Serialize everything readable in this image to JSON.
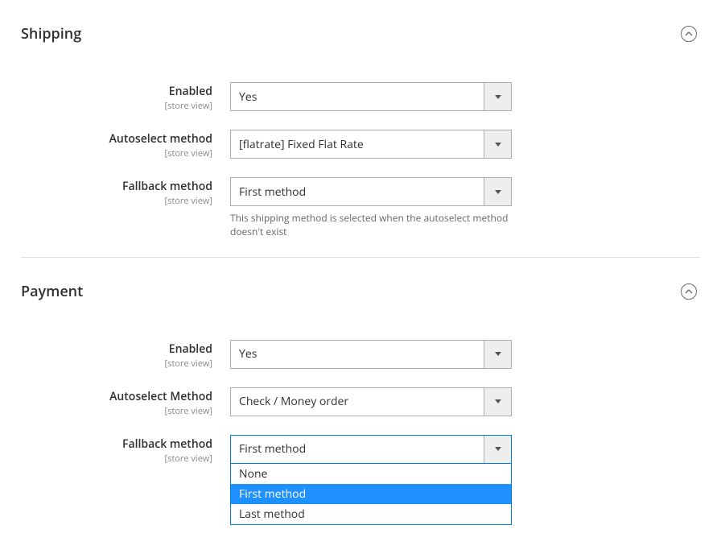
{
  "scope_label": "[store view]",
  "shipping": {
    "title": "Shipping",
    "enabled": {
      "label": "Enabled",
      "value": "Yes"
    },
    "autoselect": {
      "label": "Autoselect method",
      "value": "[flatrate] Fixed Flat Rate"
    },
    "fallback": {
      "label": "Fallback method",
      "value": "First method",
      "note": "This shipping method is selected when the autoselect method doesn't exist"
    }
  },
  "payment": {
    "title": "Payment",
    "enabled": {
      "label": "Enabled",
      "value": "Yes"
    },
    "autoselect": {
      "label": "Autoselect Method",
      "value": "Check / Money order"
    },
    "fallback": {
      "label": "Fallback method",
      "value": "First method",
      "options": [
        "None",
        "First method",
        "Last method"
      ],
      "highlighted": "First method"
    }
  }
}
